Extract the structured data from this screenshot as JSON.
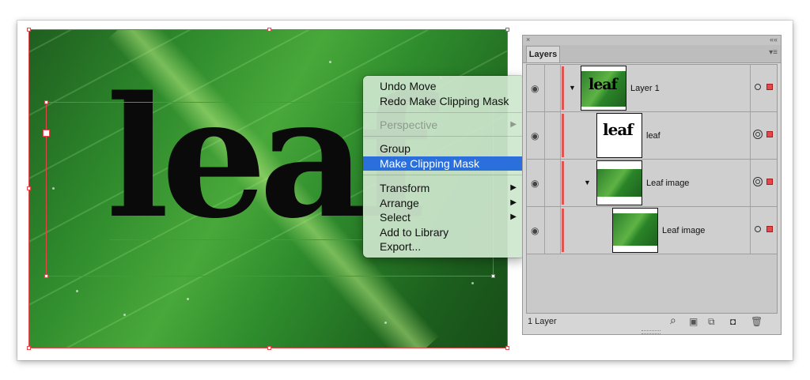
{
  "artboard": {
    "text": "leaf"
  },
  "context_menu": {
    "items": [
      {
        "label": "Undo Move"
      },
      {
        "label": "Redo Make Clipping Mask"
      },
      {
        "label": "Perspective"
      },
      {
        "label": "Group"
      },
      {
        "label": "Make Clipping Mask"
      },
      {
        "label": "Transform"
      },
      {
        "label": "Arrange"
      },
      {
        "label": "Select"
      },
      {
        "label": "Add to Library"
      },
      {
        "label": "Export..."
      }
    ],
    "highlighted": "Make Clipping Mask",
    "disabled": [
      "Perspective"
    ],
    "submenu_items": [
      "Perspective",
      "Transform",
      "Arrange",
      "Select"
    ],
    "submenu_arrow": "▶"
  },
  "layers_panel": {
    "title": "Layers",
    "close_glyph": "×",
    "collapse_glyph": "««",
    "menu_glyph": "▾≡",
    "rows": [
      {
        "name": "Layer 1",
        "thumb_text": "leaf",
        "expanded": true
      },
      {
        "name": "leaf",
        "thumb_text": "leaf"
      },
      {
        "name": "Leaf image",
        "expanded": true
      },
      {
        "name": "Leaf image"
      }
    ],
    "footer_label": "1 Layer",
    "accent_color": "#e2474a"
  },
  "icons": {
    "eye": "eye-icon",
    "expand": "disclosure-triangle-icon",
    "search": "search-icon",
    "trash": "trash-icon"
  }
}
